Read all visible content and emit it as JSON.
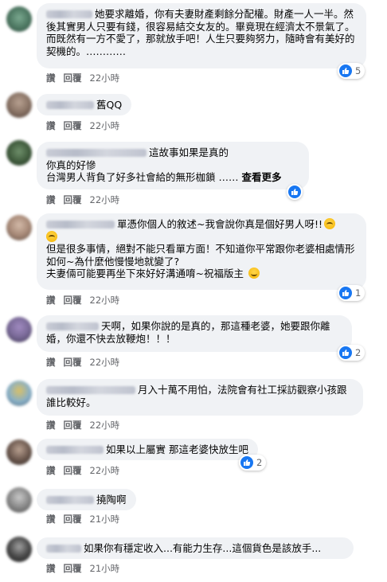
{
  "actions": {
    "like": "讚",
    "reply": "回覆"
  },
  "comments": [
    {
      "text": "她要求離婚，你有夫妻財產剩餘分配權。財產一人一半。然後其實男人只要有錢，很容易結交女友的。畢竟現在經濟太不景氣了。而既然有一方不愛了，那就放手吧！人生只要夠努力，隨時會有美好的契機的。…………",
      "time": "22小時",
      "reactions": "5"
    },
    {
      "text": "舊QQ",
      "time": "22小時"
    },
    {
      "text": "這故事如果是真的\n你真的好慘\n台灣男人背負了好多社會給的無形枷鎖 …… ",
      "see_more": "查看更多",
      "time": "22小時",
      "reactions": ""
    },
    {
      "text": "單憑你個人的敘述~我會說你真是個好男人呀!!",
      "text2": "但是很多事情，絕對不能只看單方面！不知道你平常跟你老婆相處情形如何~為什麼他慢慢地就變了?\n夫妻倆可能要再坐下來好好溝通唷~祝福版主 ",
      "time": "22小時",
      "reactions": "1"
    },
    {
      "text": "天啊，如果你說的是真的，那這種老婆，她要跟你離婚，你還不快去放鞭炮！！！",
      "time": "22小時",
      "reactions": "2"
    },
    {
      "text": "月入十萬不用怕，法院會有社工採訪觀察小孩跟誰比較好。",
      "time": "22小時"
    },
    {
      "text": "如果以上屬實 那這老婆快放生吧",
      "time": "22小時",
      "reactions": "2"
    },
    {
      "text": "撓陶啊",
      "time": "21小時"
    },
    {
      "text": "如果你有穩定收入...有能力生存...這個貨色是該放手...",
      "time": "21小時"
    }
  ],
  "colors": {
    "bubble": "#f0f2f5",
    "like_blue": "#1877f2",
    "meta_gray": "#65676b"
  },
  "icons": {
    "like": "thumbs-up-icon",
    "cry": "crying-face-icon",
    "smile": "smiling-face-icon"
  }
}
